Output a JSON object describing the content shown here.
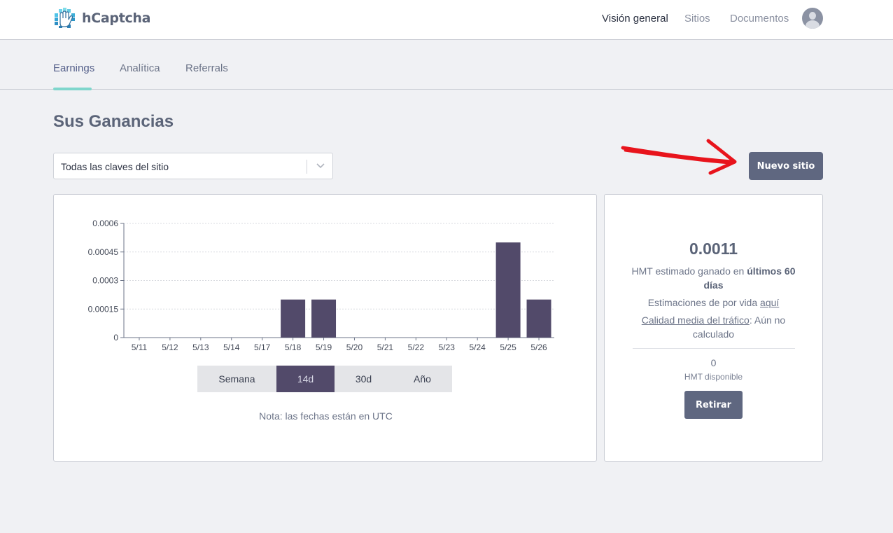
{
  "app": {
    "name": "hCaptcha"
  },
  "nav": {
    "items": [
      "Visión general",
      "Sitios",
      "Documentos"
    ],
    "active": "Visión general"
  },
  "tabs": {
    "items": [
      "Earnings",
      "Analítica",
      "Referrals"
    ],
    "active": "Earnings"
  },
  "page_title": "Sus Ganancias",
  "site_filter": {
    "selected": "Todas las claves del sitio"
  },
  "buttons": {
    "new_site": "Nuevo sitio",
    "withdraw": "Retirar"
  },
  "chart_data": {
    "type": "bar",
    "categories": [
      "5/11",
      "5/12",
      "5/13",
      "5/14",
      "5/17",
      "5/18",
      "5/19",
      "5/20",
      "5/21",
      "5/22",
      "5/23",
      "5/24",
      "5/25",
      "5/26"
    ],
    "values": [
      0,
      0,
      0,
      0,
      0,
      0.0002,
      0.0002,
      0,
      0,
      0,
      0,
      0,
      0.0005,
      0.0002
    ],
    "yticks": [
      "0",
      "0.00015",
      "0.0003",
      "0.00045",
      "0.0006"
    ],
    "ylim": [
      0,
      0.0006
    ],
    "grid": true,
    "bar_color": "#524a6a"
  },
  "range_selector": {
    "options": [
      "Semana",
      "14d",
      "30d",
      "Año"
    ],
    "active": "14d"
  },
  "note": "Nota: las fechas están en UTC",
  "summary": {
    "amount": "0.0011",
    "estimate_prefix": "HMT estimado ganado en ",
    "estimate_bold": "últimos 60 días",
    "lifetime_prefix": "Estimaciones de por vida ",
    "lifetime_link": "aquí",
    "quality_link": "Calidad media del tráfico",
    "quality_value": ": Aún no calculado",
    "available_amount": "0",
    "available_label": "HMT disponible"
  },
  "colors": {
    "accent": "#5f6780",
    "tab_underline": "#7fd6cc",
    "arrow": "#e8141c"
  }
}
